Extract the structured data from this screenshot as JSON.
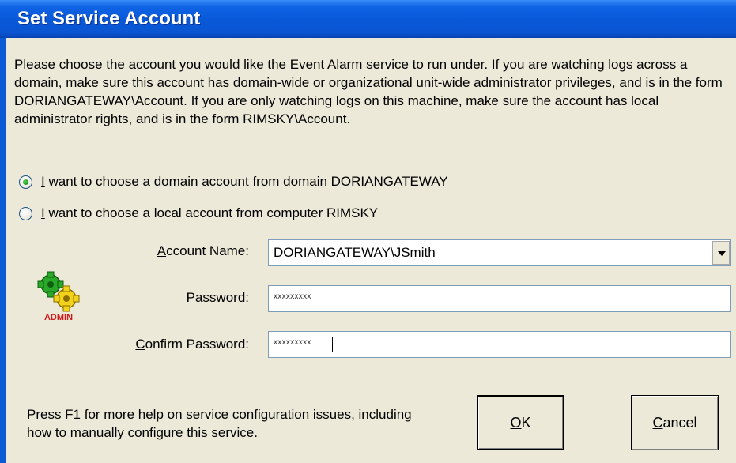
{
  "window": {
    "title": "Set Service Account"
  },
  "intro_text": "Please choose the account you would like the Event Alarm service to run under.  If you are watching logs across a domain, make sure this account has domain-wide or organizational unit-wide administrator privileges, and is in the form DORIANGATEWAY\\Account.  If you are only watching logs on this machine, make sure the account has local administrator rights, and is in the form RIMSKY\\Account.",
  "options": [
    {
      "mnemonic": "I",
      "label_rest": " want to choose a domain account from domain DORIANGATEWAY",
      "selected": true
    },
    {
      "mnemonic": "I",
      "label_rest": " want to choose a local account from computer RIMSKY",
      "selected": false
    }
  ],
  "icon": {
    "name": "admin-gears-icon",
    "caption": "ADMIN"
  },
  "fields": {
    "account_name": {
      "mnemonic": "A",
      "label_rest": "ccount Name:",
      "value": "DORIANGATEWAY\\JSmith"
    },
    "password": {
      "mnemonic": "P",
      "label_rest": "assword:",
      "value": "xxxxxxxxx"
    },
    "confirm_password": {
      "mnemonic": "C",
      "label_rest": "onfirm Password:",
      "value": "xxxxxxxxx"
    }
  },
  "help_text": "Press F1 for more help on service configuration issues, including how to manually configure this service.",
  "buttons": {
    "ok": {
      "mnemonic": "O",
      "label_rest": "K"
    },
    "cancel": {
      "mnemonic": "C",
      "label_rest": "ancel"
    }
  },
  "colors": {
    "title_bar": "#0858d8",
    "dialog_face": "#ece9d8",
    "radio_dot": "#21a121"
  }
}
